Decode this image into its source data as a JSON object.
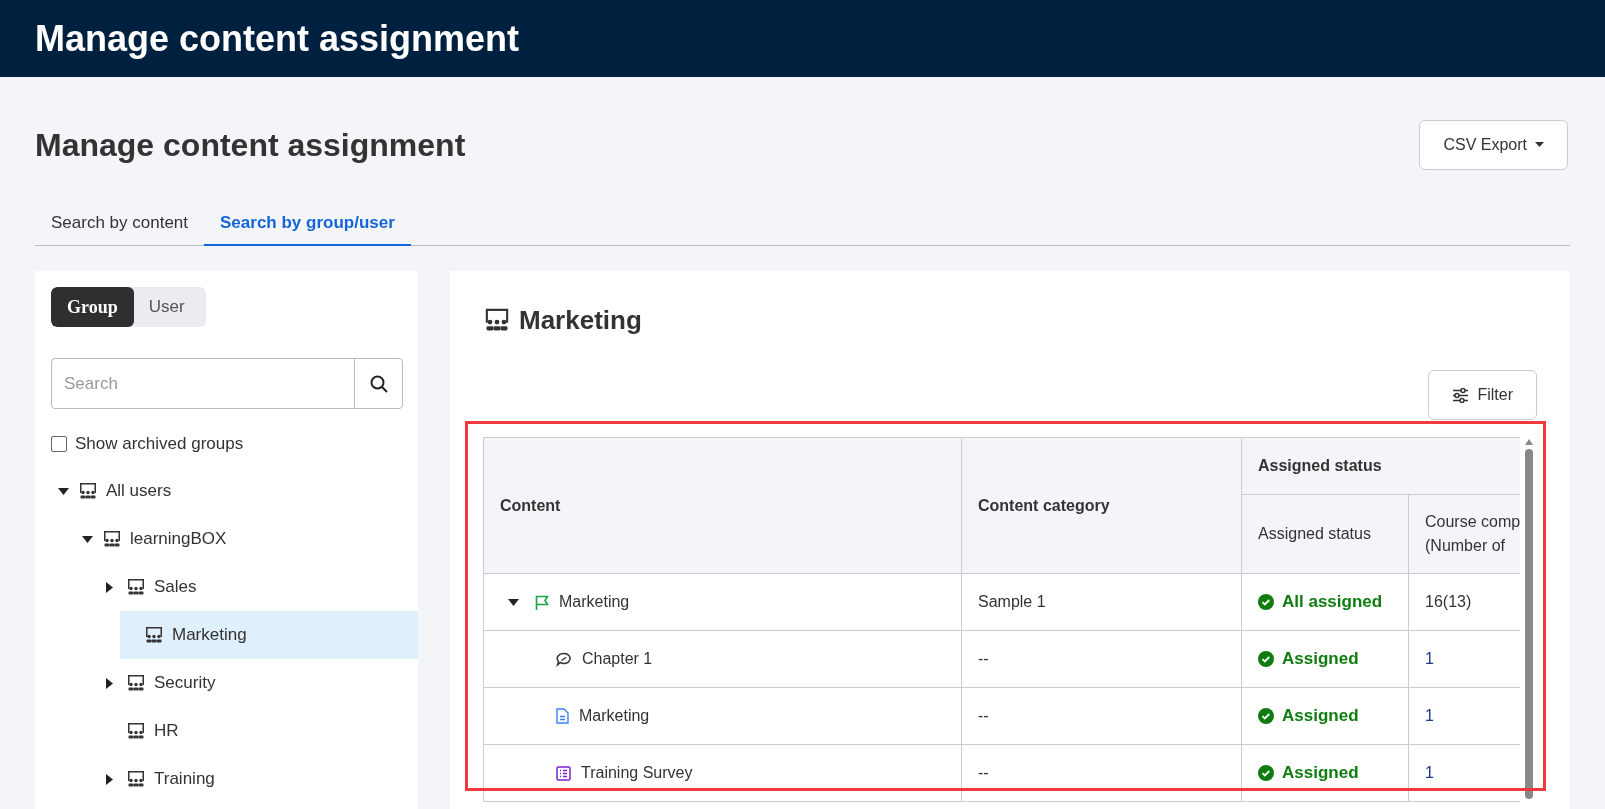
{
  "app_header": {
    "title": "Manage content assignment"
  },
  "page": {
    "title": "Manage content assignment",
    "export_button": "CSV Export"
  },
  "tabs": [
    {
      "label": "Search by content",
      "selected": false
    },
    {
      "label": "Search by group/user",
      "selected": true
    }
  ],
  "sidebar": {
    "toggle": [
      {
        "label": "Group",
        "selected": true
      },
      {
        "label": "User",
        "selected": false
      }
    ],
    "search": {
      "placeholder": "Search"
    },
    "archived": {
      "label": "Show archived groups",
      "checked": false
    },
    "tree": [
      {
        "label": "All users",
        "expanded": true,
        "selected": false,
        "children": [
          {
            "label": "learningBOX",
            "expanded": true,
            "selected": false,
            "children": [
              {
                "label": "Sales",
                "expanded": false,
                "selected": false
              },
              {
                "label": "Marketing",
                "selected": true
              },
              {
                "label": "Security",
                "expanded": false,
                "selected": false
              },
              {
                "label": "HR",
                "selected": false
              },
              {
                "label": "Training",
                "expanded": false,
                "selected": false
              }
            ]
          }
        ]
      }
    ]
  },
  "detail": {
    "title": "Marketing",
    "filter_button": "Filter",
    "table": {
      "columns": {
        "content": "Content",
        "category": "Content category",
        "group": "Assigned status",
        "status": "Assigned status",
        "column_4": [
          "Course comp",
          "(Number of"
        ]
      },
      "rows": [
        {
          "kind": "course",
          "content": "Marketing",
          "category": "Sample 1",
          "status": "All assigned",
          "column_4": "16(13)",
          "expanded": true,
          "children": [
            {
              "kind": "chapter",
              "content": "Chapter 1",
              "category": "--",
              "status": "Assigned",
              "column_4": "1"
            },
            {
              "kind": "document",
              "content": "Marketing",
              "category": "--",
              "status": "Assigned",
              "column_4": "1"
            },
            {
              "kind": "survey",
              "content": "Training Survey",
              "category": "--",
              "status": "Assigned",
              "column_4": "1"
            }
          ]
        }
      ]
    }
  }
}
